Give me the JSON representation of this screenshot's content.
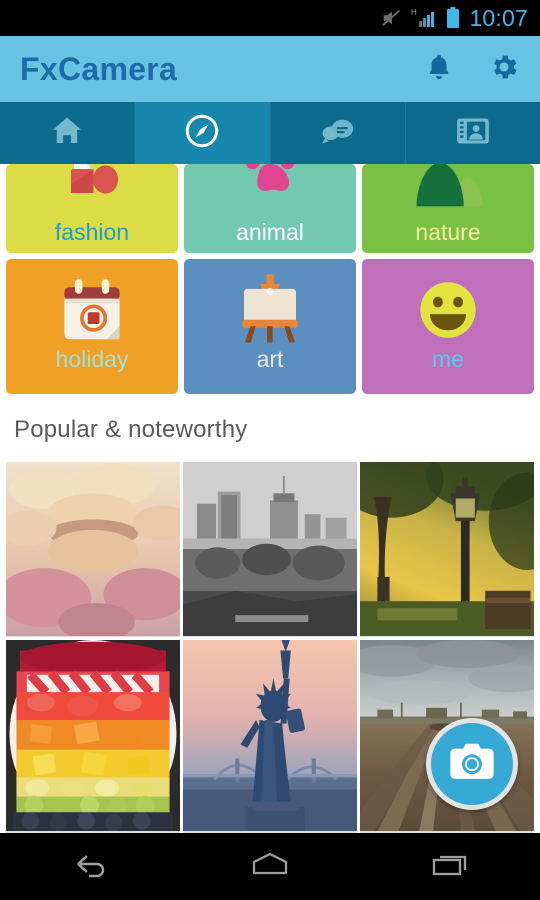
{
  "status_bar": {
    "time": "10:07",
    "icons": [
      "silent-mode-icon",
      "signal-h-icon",
      "battery-icon"
    ],
    "time_color": "#41b6e6"
  },
  "app_bar": {
    "title": "FxCamera",
    "background": "#68c3e3",
    "title_color": "#1b6ca8",
    "actions": [
      {
        "name": "notifications-icon",
        "label": "Notifications"
      },
      {
        "name": "settings-gear-icon",
        "label": "Settings"
      }
    ]
  },
  "tabs": [
    {
      "name": "tab-home",
      "icon": "home-icon",
      "label": "Home",
      "active": false
    },
    {
      "name": "tab-explore",
      "icon": "compass-icon",
      "label": "Explore",
      "active": true
    },
    {
      "name": "tab-messages",
      "icon": "chat-bubbles-icon",
      "label": "Messages",
      "active": false
    },
    {
      "name": "tab-profile",
      "icon": "contact-card-icon",
      "label": "Profile",
      "active": false
    }
  ],
  "categories": [
    {
      "label": "fashion",
      "icon": "nail-polish-icon",
      "bg": "#dcdc46",
      "text": "#1e9ec8"
    },
    {
      "label": "animal",
      "icon": "paw-print-icon",
      "bg": "#72c9ae",
      "text": "#ffffff"
    },
    {
      "label": "nature",
      "icon": "mountains-icon",
      "bg": "#7ac143",
      "text": "#f2f0a0"
    },
    {
      "label": "holiday",
      "icon": "calendar-icon",
      "bg": "#f0a024",
      "text": "#9fe0da"
    },
    {
      "label": "art",
      "icon": "easel-icon",
      "bg": "#5b8fc0",
      "text": "#e8e8e8"
    },
    {
      "label": "me",
      "icon": "smiley-face-icon",
      "bg": "#c070bb",
      "text": "#5fc8f0"
    }
  ],
  "section": {
    "title": "Popular & noteworthy"
  },
  "photos": [
    {
      "name": "photo-macarons",
      "alt": "Stack of pastel macarons"
    },
    {
      "name": "photo-cityscape",
      "alt": "Black and white city skyline"
    },
    {
      "name": "photo-lamppost",
      "alt": "Park lamp post at golden sunset"
    },
    {
      "name": "photo-fruit-platter",
      "alt": "Rainbow fruit platter"
    },
    {
      "name": "photo-statue-liberty",
      "alt": "Statue of Liberty at dusk"
    },
    {
      "name": "photo-muddy-field",
      "alt": "Muddy field under cloudy sky"
    }
  ],
  "fab": {
    "name": "camera-shutter-button",
    "icon": "camera-icon",
    "background": "#36a9d4",
    "ring": "#e3e3e3"
  },
  "nav_bar": {
    "buttons": [
      {
        "name": "android-back-button",
        "icon": "back-arrow-icon"
      },
      {
        "name": "android-home-button",
        "icon": "home-pentagon-icon"
      },
      {
        "name": "android-recents-button",
        "icon": "recents-icon"
      }
    ]
  }
}
